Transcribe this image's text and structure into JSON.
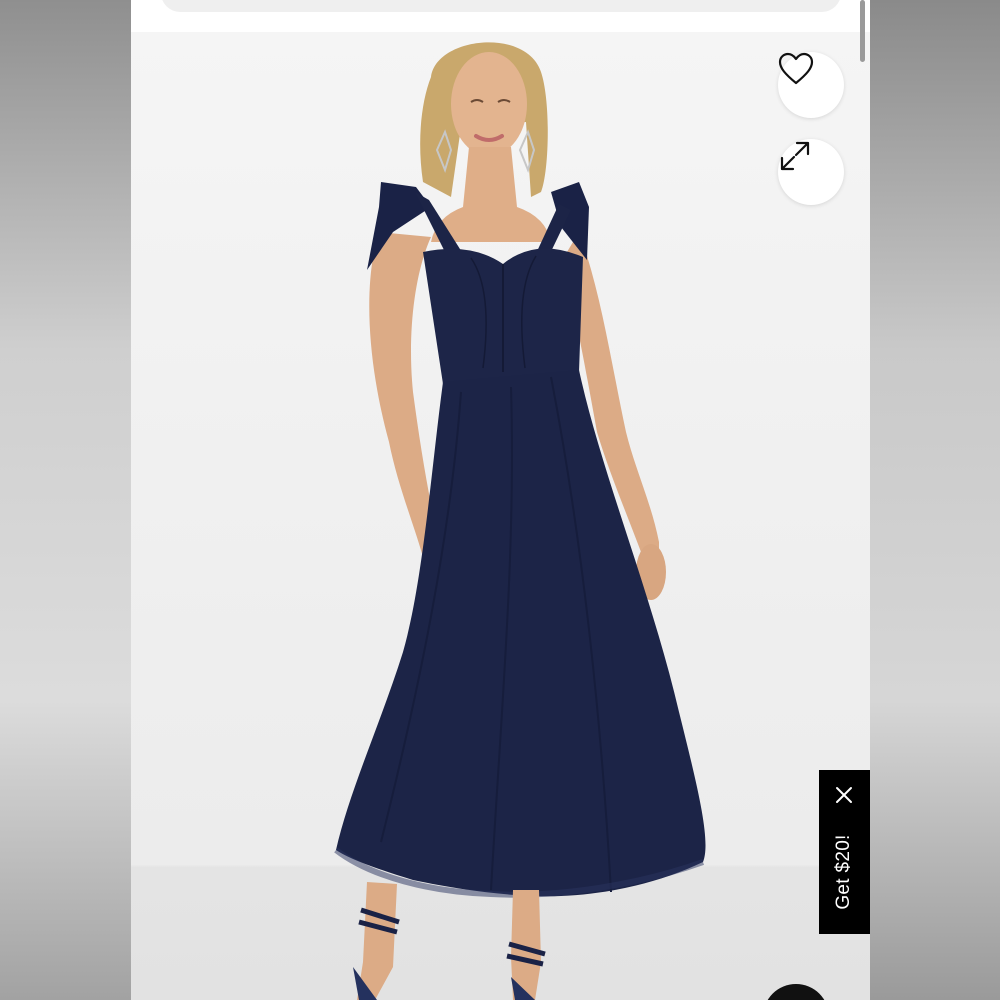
{
  "page": {
    "product_image": "navy-tie-strap-sweetheart-midi-dress-photo"
  },
  "actions": {
    "wishlist_icon": "heart-icon",
    "expand_icon": "expand-arrows-icon"
  },
  "promo": {
    "label": "Get $20!",
    "close_icon": "close-icon"
  },
  "chat": {
    "icon": "chat-launcher-icon"
  },
  "colors": {
    "dress": "#1c2447",
    "background": "#efefef",
    "promo_bg": "#000000",
    "promo_text": "#ffffff"
  }
}
